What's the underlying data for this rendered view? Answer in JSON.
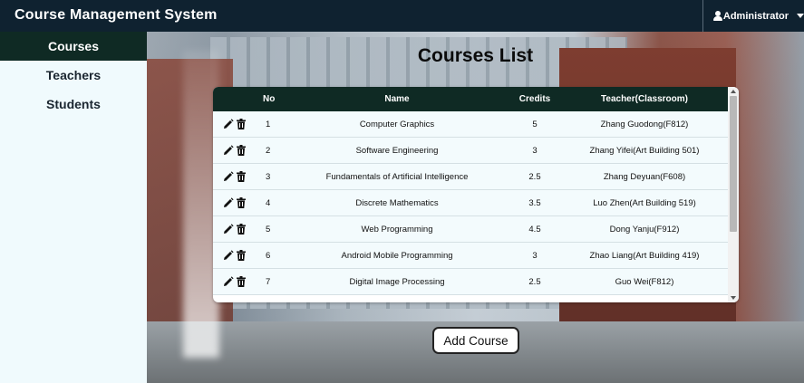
{
  "app": {
    "title": "Course Management System"
  },
  "user": {
    "name": "Administrator"
  },
  "sidebar": {
    "items": [
      {
        "label": "Courses",
        "active": true
      },
      {
        "label": "Teachers",
        "active": false
      },
      {
        "label": "Students",
        "active": false
      }
    ]
  },
  "main": {
    "title": "Courses List",
    "add_button_label": "Add Course"
  },
  "table": {
    "headers": {
      "no": "No",
      "name": "Name",
      "credits": "Credits",
      "teacher": "Teacher(Classroom)"
    },
    "rows": [
      {
        "no": "1",
        "name": "Computer Graphics",
        "credits": "5",
        "teacher": "Zhang Guodong(F812)"
      },
      {
        "no": "2",
        "name": "Software Engineering",
        "credits": "3",
        "teacher": "Zhang Yifei(Art Building 501)"
      },
      {
        "no": "3",
        "name": "Fundamentals of Artificial Intelligence",
        "credits": "2.5",
        "teacher": "Zhang Deyuan(F608)"
      },
      {
        "no": "4",
        "name": "Discrete Mathematics",
        "credits": "3.5",
        "teacher": "Luo Zhen(Art Building 519)"
      },
      {
        "no": "5",
        "name": "Web Programming",
        "credits": "4.5",
        "teacher": "Dong Yanju(F912)"
      },
      {
        "no": "6",
        "name": "Android Mobile Programming",
        "credits": "3",
        "teacher": "Zhao Liang(Art Building 419)"
      },
      {
        "no": "7",
        "name": "Digital Image Processing",
        "credits": "2.5",
        "teacher": "Guo Wei(F812)"
      }
    ]
  },
  "icons": {
    "edit": "pencil-icon",
    "delete": "trash-icon",
    "user": "user-icon",
    "dropdown": "caret-down-icon"
  },
  "colors": {
    "navbar": "#0f2230",
    "active_sidebar": "#0f2a24",
    "table_header": "#0f2a24",
    "row_bg": "#f3fbfd"
  }
}
